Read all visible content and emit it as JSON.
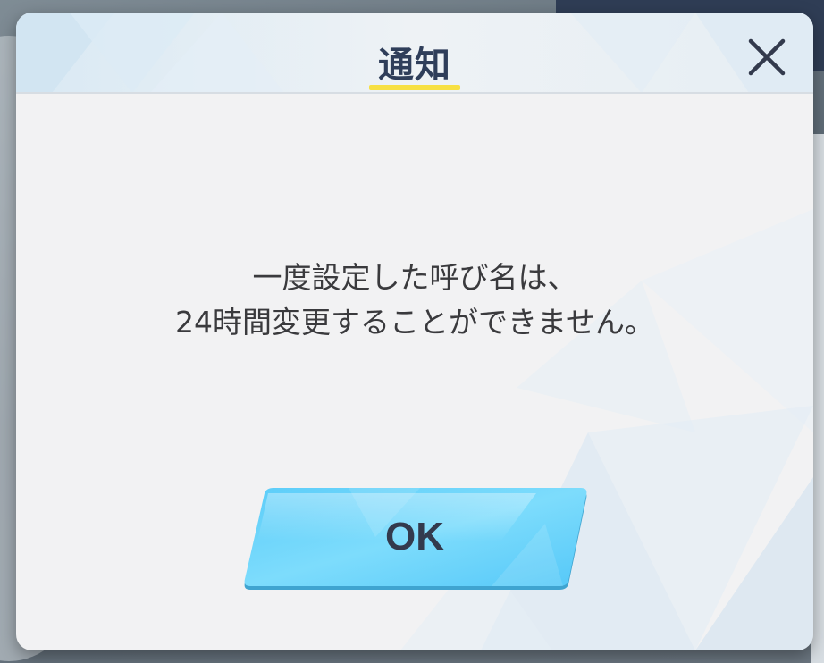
{
  "dialog": {
    "title": "通知",
    "message_line1": "一度設定した呼び名は、",
    "message_line2": "24時間変更することができません。",
    "ok_label": "OK",
    "close_icon": "close-icon"
  },
  "colors": {
    "title": "#2f3e5a",
    "title_underline": "#f7e043",
    "ok_button": "#66d3fb",
    "panel": "#f2f2f3"
  }
}
